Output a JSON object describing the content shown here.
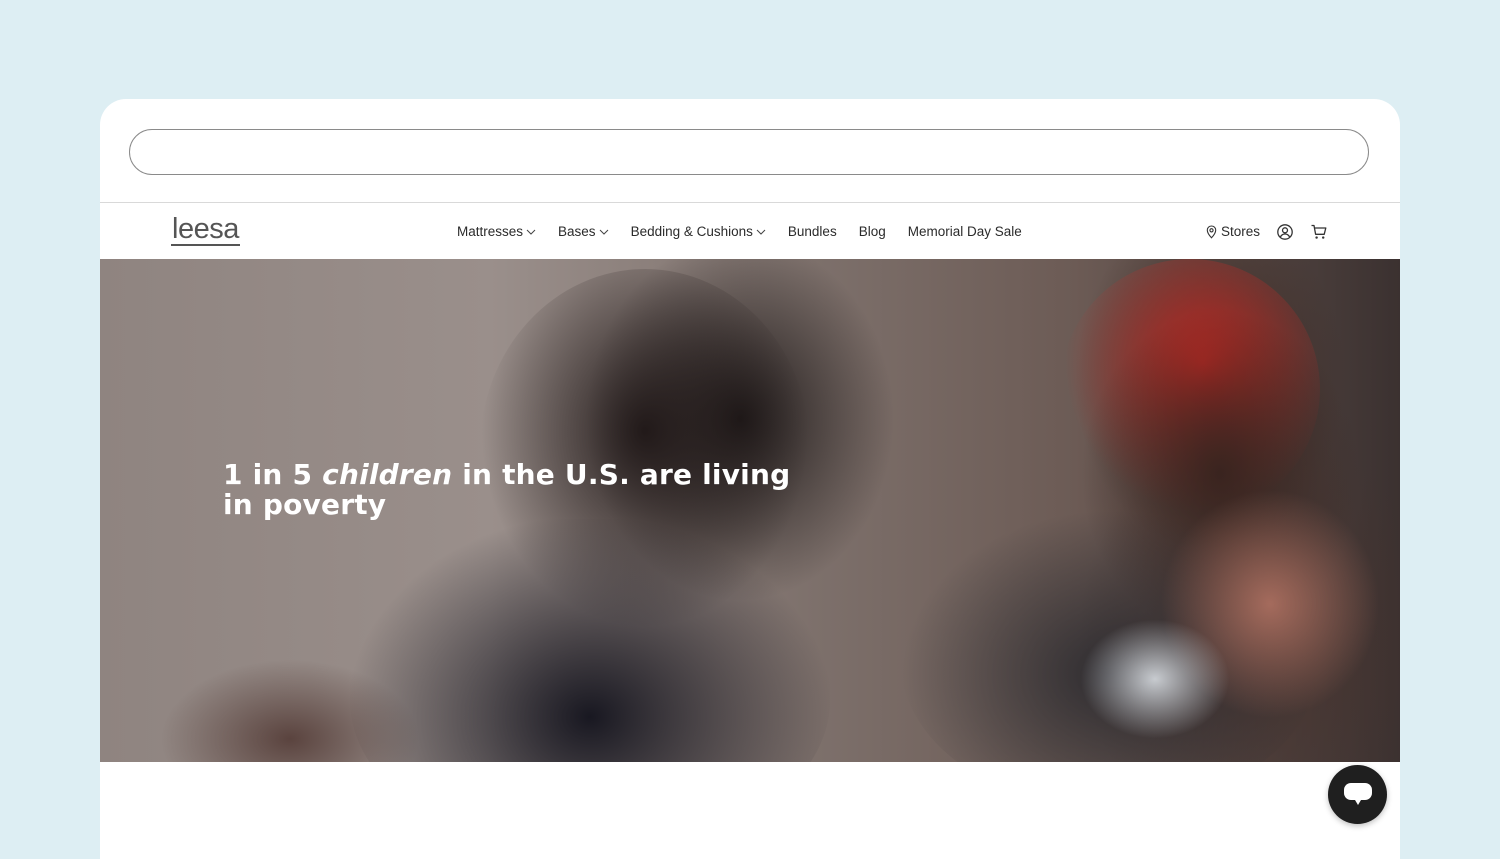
{
  "browser": {
    "address_value": ""
  },
  "header": {
    "logo_text": "leesa",
    "nav": [
      {
        "label": "Mattresses",
        "has_dropdown": true
      },
      {
        "label": "Bases",
        "has_dropdown": true
      },
      {
        "label": "Bedding & Cushions",
        "has_dropdown": true
      },
      {
        "label": "Bundles",
        "has_dropdown": false
      },
      {
        "label": "Blog",
        "has_dropdown": false
      },
      {
        "label": "Memorial Day Sale",
        "has_dropdown": false
      }
    ],
    "stores_label": "Stores",
    "icons": [
      "location-pin-icon",
      "account-icon",
      "cart-icon"
    ]
  },
  "hero": {
    "headline_part1": "1 in 5 ",
    "headline_emphasis": "children",
    "headline_part2": " in the U.S. are living in poverty"
  },
  "chat": {
    "icon": "chat-bubble-icon"
  },
  "colors": {
    "page_background": "#ddeef3",
    "text_dark": "#2b2b2b",
    "logo_gray": "#555555",
    "chat_button": "#1f1f1f"
  }
}
